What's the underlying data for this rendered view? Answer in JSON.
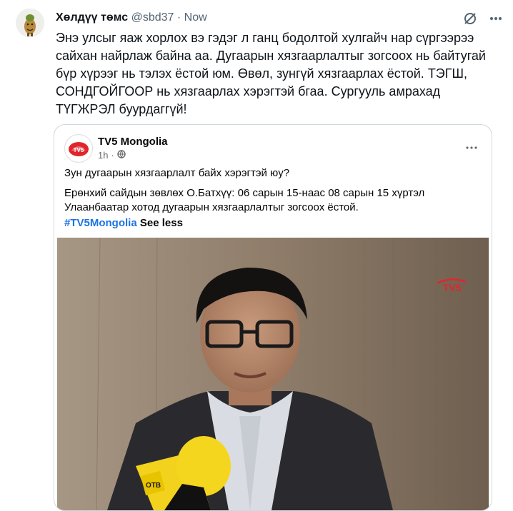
{
  "tweet": {
    "author_name": "Хөлдүү төмс",
    "handle": "@sbd37",
    "separator": "·",
    "time": "Now",
    "text": "Энэ улсыг яаж хорлох вэ гэдэг л ганц бодолтой хулгайч нар сүргээрээ сайхан найрлаж байна аа. Дугаарын хязгаарлалтыг зогсоох нь байтугай бүр хүрээг нь тэлэх ёстой юм. Өвөл, зунгүй хязгаарлах ёстой. ТЭГШ, СОНДГОЙГООР нь хязгаарлах хэрэгтэй бгаа. Сургууль амрахад ТҮГЖРЭЛ буурдаггүй!"
  },
  "icons": {
    "avatar": "potato-avatar",
    "grok": "grok-icon",
    "more": "more-icon"
  },
  "embed": {
    "page_name": "TV5 Mongolia",
    "time_ago": "1h",
    "visibility_icon": "globe-icon",
    "question": "Зун дугаарын хязгаарлалт байх хэрэгтэй юу?",
    "body": "Ерөнхий сайдын зөвлөх О.Батхүү: 06 сарын 15-наас 08 сарын 15 хүртэл Улаанбаатар хотод дугаарын хязгаарлалтыг зогсоох ёстой.",
    "hashtag": "#TV5Mongolia",
    "see_less": "See less",
    "logo_text": "TV5",
    "watermark": "TV5",
    "mic_text": "ОТВ"
  },
  "colors": {
    "text": "#0f1419",
    "secondary": "#536471",
    "link": "#1b74e4",
    "tv5_red": "#e0262b"
  }
}
